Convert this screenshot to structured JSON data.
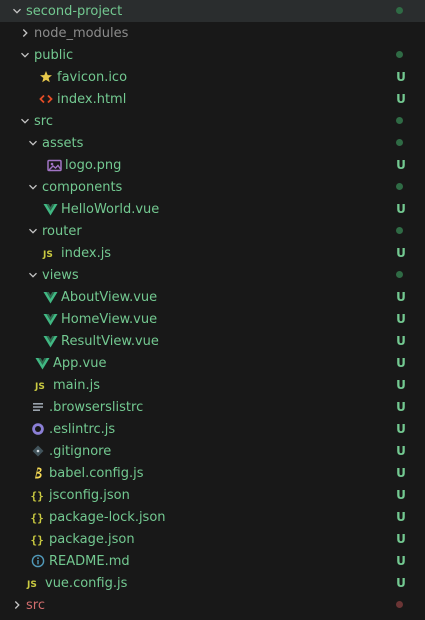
{
  "colors": {
    "untracked": "#73c991",
    "folder_dot": "#2f6b45",
    "dim": "#8c8c8c",
    "error_label": "#d16d6d",
    "error_dot": "#6b3535"
  },
  "tree": [
    {
      "label": "second-project",
      "type": "folder",
      "open": true,
      "depth": 0,
      "status": "dot"
    },
    {
      "label": "node_modules",
      "type": "folder",
      "open": false,
      "depth": 1,
      "status": "none",
      "dim": true
    },
    {
      "label": "public",
      "type": "folder",
      "open": true,
      "depth": 1,
      "status": "dot"
    },
    {
      "label": "favicon.ico",
      "type": "file",
      "icon": "star-icon",
      "depth": 2,
      "status": "U"
    },
    {
      "label": "index.html",
      "type": "file",
      "icon": "html-icon",
      "depth": 2,
      "status": "U"
    },
    {
      "label": "src",
      "type": "folder",
      "open": true,
      "depth": 1,
      "status": "dot"
    },
    {
      "label": "assets",
      "type": "folder",
      "open": true,
      "depth": 2,
      "status": "dot"
    },
    {
      "label": "logo.png",
      "type": "file",
      "icon": "image-icon",
      "depth": 3,
      "status": "U"
    },
    {
      "label": "components",
      "type": "folder",
      "open": true,
      "depth": 2,
      "status": "dot"
    },
    {
      "label": "HelloWorld.vue",
      "type": "file",
      "icon": "vue-icon",
      "depth": 3,
      "status": "U"
    },
    {
      "label": "router",
      "type": "folder",
      "open": true,
      "depth": 2,
      "status": "dot"
    },
    {
      "label": "index.js",
      "type": "file",
      "icon": "js-icon",
      "depth": 3,
      "status": "U"
    },
    {
      "label": "views",
      "type": "folder",
      "open": true,
      "depth": 2,
      "status": "dot"
    },
    {
      "label": "AboutView.vue",
      "type": "file",
      "icon": "vue-icon",
      "depth": 3,
      "status": "U"
    },
    {
      "label": "HomeView.vue",
      "type": "file",
      "icon": "vue-icon",
      "depth": 3,
      "status": "U"
    },
    {
      "label": "ResultView.vue",
      "type": "file",
      "icon": "vue-icon",
      "depth": 3,
      "status": "U"
    },
    {
      "label": "App.vue",
      "type": "file",
      "icon": "vue-icon",
      "depth": 2,
      "status": "U"
    },
    {
      "label": "main.js",
      "type": "file",
      "icon": "js-icon",
      "depth": 2,
      "status": "U"
    },
    {
      "label": ".browserslistrc",
      "type": "file",
      "icon": "lines-icon",
      "depth": 1,
      "status": "U"
    },
    {
      "label": ".eslintrc.js",
      "type": "file",
      "icon": "eslint-icon",
      "depth": 1,
      "status": "U"
    },
    {
      "label": ".gitignore",
      "type": "file",
      "icon": "git-icon",
      "depth": 1,
      "status": "U"
    },
    {
      "label": "babel.config.js",
      "type": "file",
      "icon": "babel-icon",
      "depth": 1,
      "status": "U"
    },
    {
      "label": "jsconfig.json",
      "type": "file",
      "icon": "json-icon",
      "depth": 1,
      "status": "U"
    },
    {
      "label": "package-lock.json",
      "type": "file",
      "icon": "json-icon",
      "depth": 1,
      "status": "U"
    },
    {
      "label": "package.json",
      "type": "file",
      "icon": "json-icon",
      "depth": 1,
      "status": "U"
    },
    {
      "label": "README.md",
      "type": "file",
      "icon": "info-icon",
      "depth": 1,
      "status": "U"
    },
    {
      "label": "vue.config.js",
      "type": "file",
      "icon": "js-icon",
      "depth": 1,
      "status": "U"
    },
    {
      "label": "src",
      "type": "folder",
      "open": false,
      "depth": 0,
      "status": "reddot",
      "error": true
    }
  ]
}
